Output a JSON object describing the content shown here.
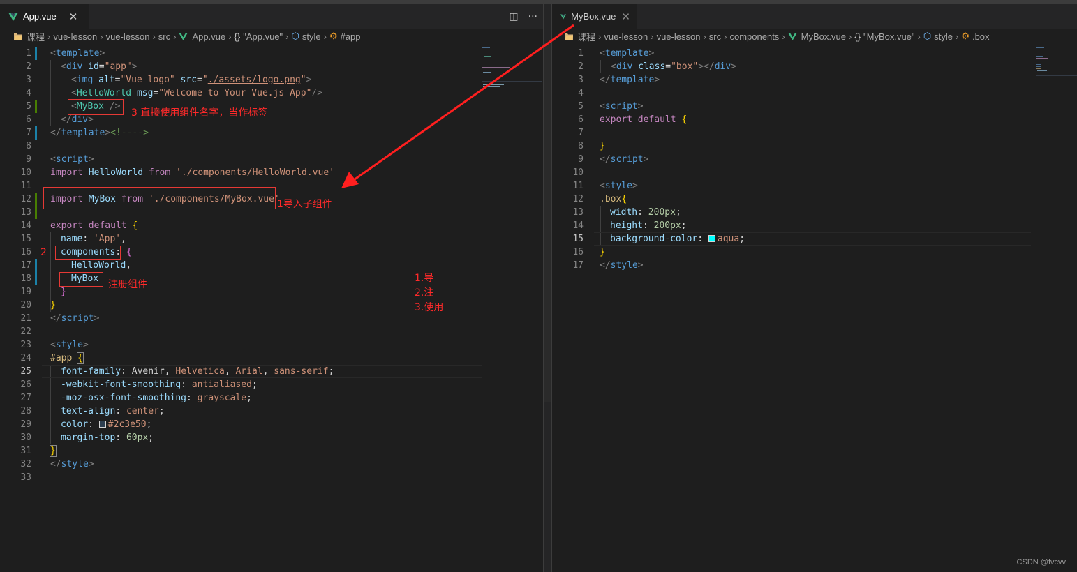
{
  "left": {
    "tab": {
      "label": "App.vue",
      "close": "✕"
    },
    "actions": {
      "split": "◫",
      "more": "···"
    },
    "breadcrumb": [
      "课程",
      "vue-lesson",
      "vue-lesson",
      "src",
      "App.vue",
      "\"App.vue\"",
      "style",
      "#app"
    ],
    "active_line": "25"
  },
  "right": {
    "tab": {
      "label": "MyBox.vue",
      "close": "✕"
    },
    "breadcrumb": [
      "课程",
      "vue-lesson",
      "vue-lesson",
      "src",
      "components",
      "MyBox.vue",
      "\"MyBox.vue\"",
      "style",
      ".box"
    ],
    "active_line": "15"
  },
  "annotations": {
    "step3": "3  直接使用组件名字，当作标签",
    "step1": "1导入子组件",
    "step2_num": "2",
    "register": "注册组件",
    "summary": [
      "1.导",
      "2.注",
      "3.使用"
    ]
  },
  "colors": {
    "swatch_2c3e50": "#2c3e50",
    "swatch_aqua": "#00ffff",
    "annotation": "#ff2a2a"
  },
  "watermark": "CSDN @fvcvv"
}
